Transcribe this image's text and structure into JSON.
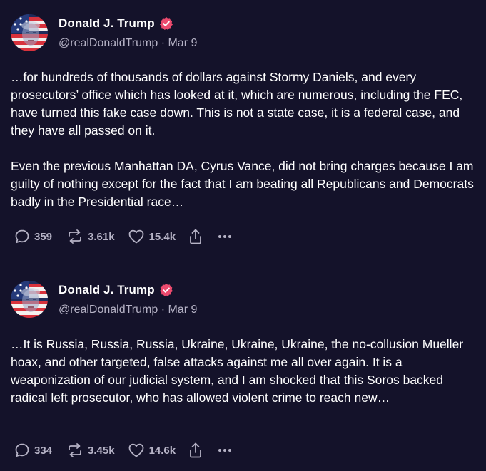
{
  "colors": {
    "background": "#14122a",
    "text": "#ffffff",
    "muted": "#b6b3c6",
    "verified_badge": "#ec4a6e",
    "divider": "#3a3850"
  },
  "posts": [
    {
      "author": {
        "display_name": "Donald J. Trump",
        "handle_line": "@realDonaldTrump · Mar 9",
        "verified": true,
        "avatar": "flag-portrait-avatar"
      },
      "body": "…for hundreds of thousands of dollars against Stormy Daniels, and every prosecutors’ office which has looked at it, which are numerous, including the FEC, have turned this fake case down. This is not a state case, it is a federal case, and they have all passed on it.\n\nEven the previous Manhattan DA, Cyrus Vance, did not bring charges because I am guilty of nothing except for the fact that I am beating all Republicans and Democrats badly in the Presidential race…",
      "stats": {
        "replies": "359",
        "reposts": "3.61k",
        "likes": "15.4k"
      }
    },
    {
      "author": {
        "display_name": "Donald J. Trump",
        "handle_line": "@realDonaldTrump · Mar 9",
        "verified": true,
        "avatar": "flag-portrait-avatar"
      },
      "body": "…It is Russia, Russia, Russia, Ukraine, Ukraine, Ukraine, the no-collusion Mueller hoax, and other targeted, false attacks against me all over again. It is a weaponization of our judicial system, and I am shocked that this Soros backed radical left prosecutor, who has allowed violent crime to reach new…",
      "stats": {
        "replies": "334",
        "reposts": "3.45k",
        "likes": "14.6k"
      }
    }
  ],
  "icons": {
    "reply": "reply-bubble-icon",
    "repost": "repost-arrows-icon",
    "like": "heart-icon",
    "share": "share-upload-icon",
    "more": "more-dots-icon",
    "verified": "verified-badge-icon"
  }
}
